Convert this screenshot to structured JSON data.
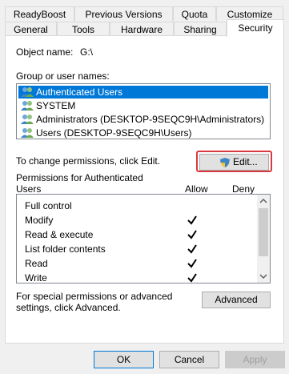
{
  "tabs_row1": [
    "ReadyBoost",
    "Previous Versions",
    "Quota",
    "Customize"
  ],
  "tabs_row2": [
    "General",
    "Tools",
    "Hardware",
    "Sharing",
    "Security"
  ],
  "object": {
    "label": "Object name:",
    "value": "G:\\"
  },
  "group": {
    "label": "Group or user names:",
    "items": [
      "Authenticated Users",
      "SYSTEM",
      "Administrators (DESKTOP-9SEQC9H\\Administrators)",
      "Users (DESKTOP-9SEQC9H\\Users)"
    ],
    "selected_index": 0
  },
  "change_text": "To change permissions, click Edit.",
  "edit_button": "Edit...",
  "permissions": {
    "label": "Permissions for Authenticated Users",
    "allow_header": "Allow",
    "deny_header": "Deny",
    "rows": [
      {
        "name": "Full control",
        "allow": false,
        "deny": false
      },
      {
        "name": "Modify",
        "allow": true,
        "deny": false
      },
      {
        "name": "Read & execute",
        "allow": true,
        "deny": false
      },
      {
        "name": "List folder contents",
        "allow": true,
        "deny": false
      },
      {
        "name": "Read",
        "allow": true,
        "deny": false
      },
      {
        "name": "Write",
        "allow": true,
        "deny": false
      }
    ]
  },
  "special_text": "For special permissions or advanced settings, click Advanced.",
  "advanced_button": "Advanced",
  "footer": {
    "ok": "OK",
    "cancel": "Cancel",
    "apply": "Apply"
  },
  "colors": {
    "selection": "#0078d7",
    "highlight_box": "#d9393e"
  }
}
